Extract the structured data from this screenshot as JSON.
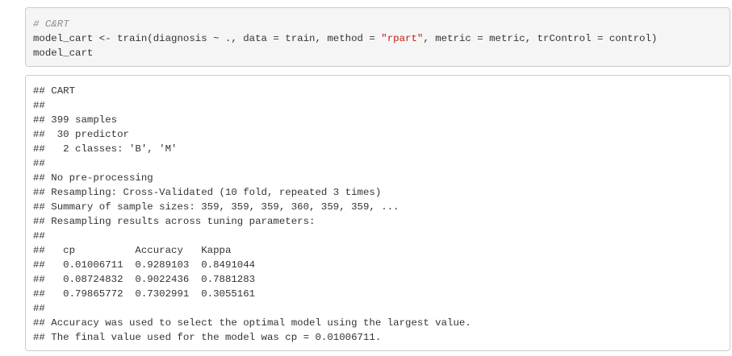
{
  "code": {
    "comment": "# C&RT",
    "line2_pre": "model_cart <- train(diagnosis ~ ., data = train, method = ",
    "line2_str": "\"rpart\"",
    "line2_post": ", metric = metric, trControl = control)",
    "line3": "model_cart"
  },
  "output": {
    "lines": [
      "## CART",
      "##",
      "## 399 samples",
      "##  30 predictor",
      "##   2 classes: 'B', 'M'",
      "##",
      "## No pre-processing",
      "## Resampling: Cross-Validated (10 fold, repeated 3 times)",
      "## Summary of sample sizes: 359, 359, 359, 360, 359, 359, ...",
      "## Resampling results across tuning parameters:",
      "##",
      "##   cp          Accuracy   Kappa",
      "##   0.01006711  0.9289103  0.8491044",
      "##   0.08724832  0.9022436  0.7881283",
      "##   0.79865772  0.7302991  0.3055161",
      "##",
      "## Accuracy was used to select the optimal model using the largest value.",
      "## The final value used for the model was cp = 0.01006711."
    ]
  },
  "colors": {
    "comment": "#8e908c",
    "string": "#c41a16",
    "text": "#333333",
    "code_bg": "#f5f5f5",
    "border": "#cccccc"
  }
}
